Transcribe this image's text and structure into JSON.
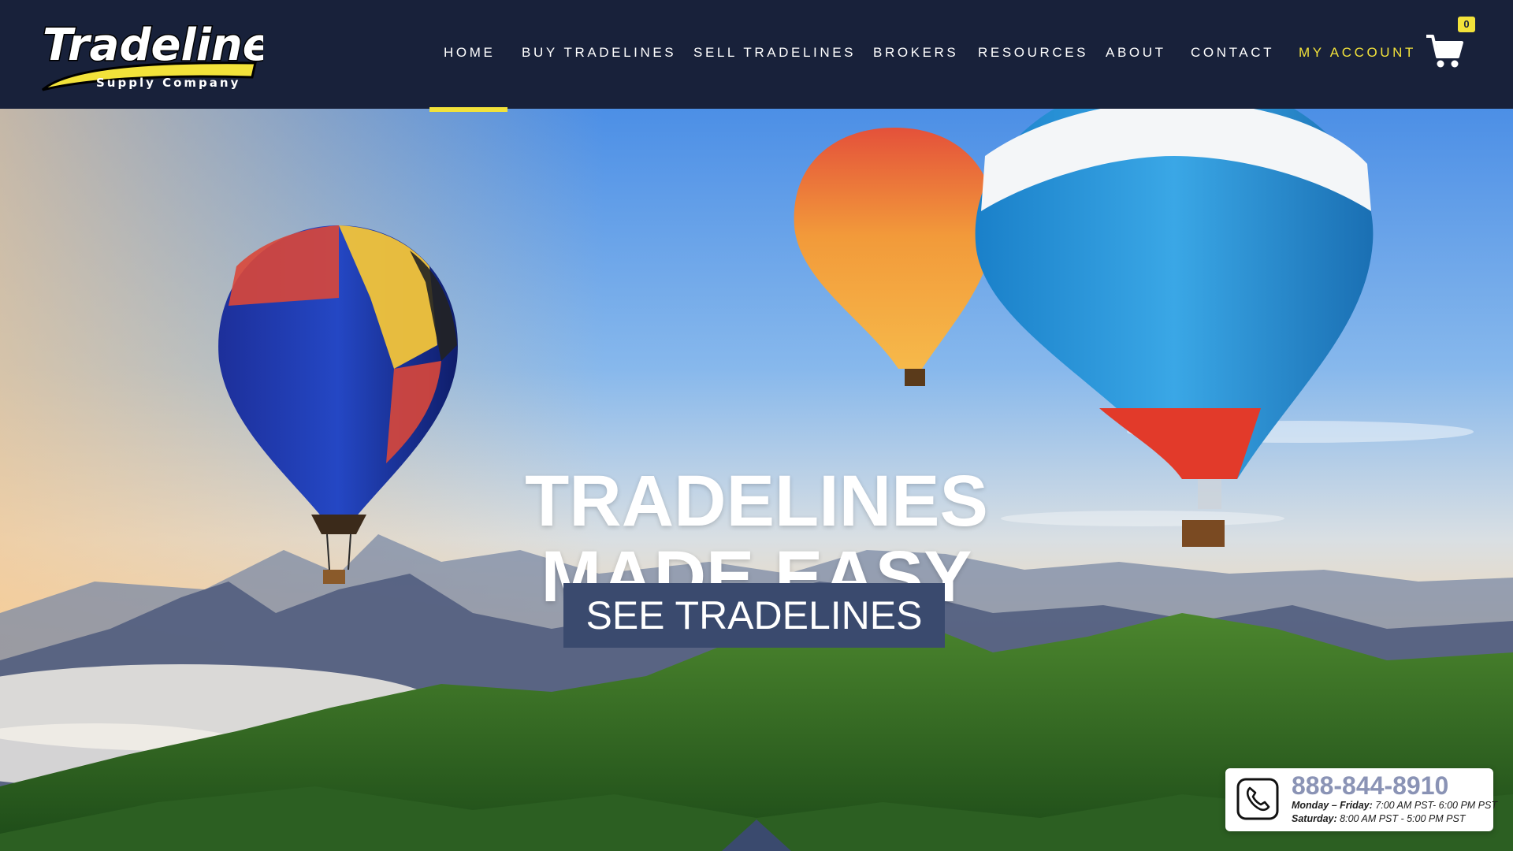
{
  "brand": {
    "name": "Tradeline",
    "tagline": "Supply Company"
  },
  "nav": {
    "items": [
      {
        "label": "HOME",
        "active": true
      },
      {
        "label": "BUY TRADELINES"
      },
      {
        "label": "SELL TRADELINES"
      },
      {
        "label": "BROKERS"
      },
      {
        "label": "RESOURCES"
      },
      {
        "label": "ABOUT"
      },
      {
        "label": "CONTACT"
      },
      {
        "label": "MY ACCOUNT",
        "highlight": true
      }
    ],
    "cart_icon": "shopping-cart-icon",
    "cart_count": "0"
  },
  "hero": {
    "title_line1": "TRADELINES",
    "title_line2": "MADE EASY",
    "cta_label": "SEE TRADELINES"
  },
  "contact": {
    "phone_icon": "phone-icon",
    "phone": "888-844-8910",
    "weekday_label": "Monday – Friday:",
    "weekday_hours": "7:00 AM PST- 6:00 PM PST",
    "saturday_label": "Saturday:",
    "saturday_hours": "8:00 AM PST - 5:00 PM PST"
  },
  "colors": {
    "header_bg": "#18213a",
    "accent_yellow": "#f2e23a",
    "cta_bg": "#3a4a6e",
    "phone_text": "#8a93b5"
  }
}
